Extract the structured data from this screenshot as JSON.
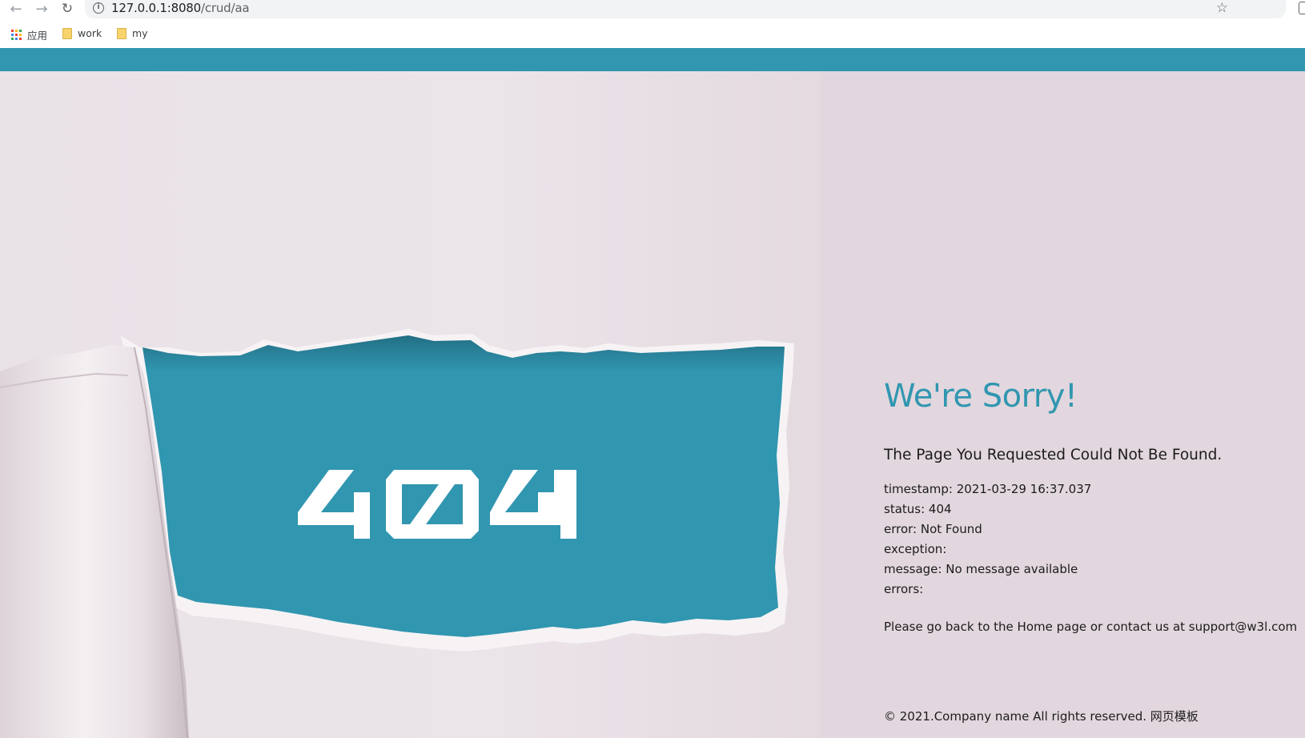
{
  "browser": {
    "url_host": "127.0.0.1:8080",
    "url_path": "/crud/aa",
    "bookmarks": [
      {
        "label": "应用",
        "icon": "apps-grid-icon"
      },
      {
        "label": "work",
        "icon": "folder-icon"
      },
      {
        "label": "my",
        "icon": "folder-icon"
      }
    ]
  },
  "colors": {
    "accent": "#3196b0",
    "background": "#e2d7de"
  },
  "hero": {
    "code": "404"
  },
  "message": {
    "title": "We're Sorry!",
    "subtitle": "The Page You Requested Could Not Be Found.",
    "timestamp": "timestamp: 2021-03-29 16:37.037",
    "status": "status: 404",
    "error": "error: Not Found",
    "exception": "exception:",
    "message": "message: No message available",
    "errors": "errors:",
    "contact": "Please go back to the Home page or contact us at support@w3l.com"
  },
  "footer": {
    "text": "© 2021.Company name All rights reserved. 网页模板"
  }
}
